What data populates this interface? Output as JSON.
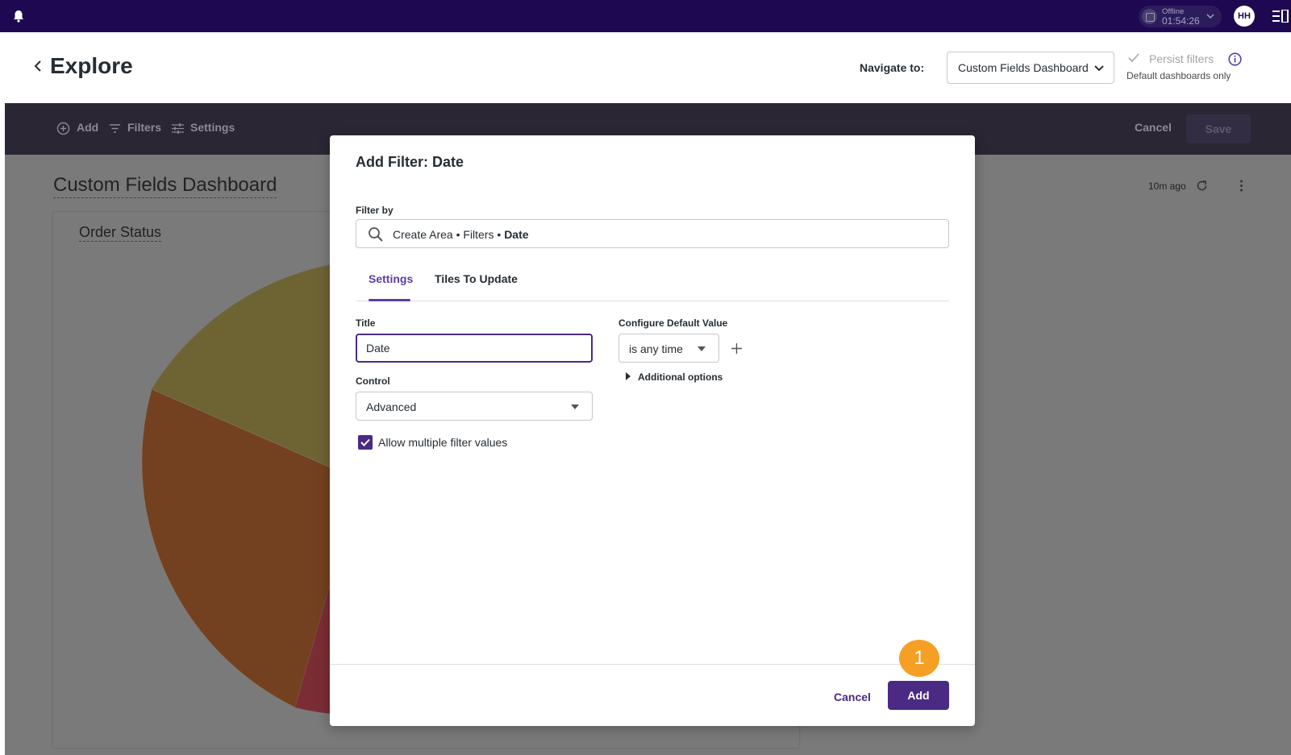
{
  "topbar": {
    "timer_status": "Offline",
    "timer_time": "01:54:26",
    "avatar_initials": "HH"
  },
  "header": {
    "title": "Explore",
    "navigate_label": "Navigate to:",
    "navigate_value": "Custom Fields Dashboard",
    "persist_label": "Persist filters",
    "persist_sub": "Default dashboards only"
  },
  "toolbar": {
    "add_label": "Add",
    "filters_label": "Filters",
    "settings_label": "Settings",
    "cancel_label": "Cancel",
    "save_label": "Save"
  },
  "dashboard": {
    "title": "Custom Fields Dashboard",
    "updated": "10m ago",
    "tile_title": "Order Status"
  },
  "modal": {
    "title": "Add Filter: Date",
    "filter_by_label": "Filter by",
    "filter_path_prefix": "Create Area • Filters • ",
    "filter_path_field": "Date",
    "tabs": [
      {
        "label": "Settings"
      },
      {
        "label": "Tiles To Update"
      }
    ],
    "title_label": "Title",
    "title_value": "Date",
    "control_label": "Control",
    "control_value": "Advanced",
    "allow_multiple_label": "Allow multiple filter values",
    "allow_multiple_checked": true,
    "default_value_label": "Configure Default Value",
    "default_value": "is any time",
    "additional_options_label": "Additional options",
    "cancel_label": "Cancel",
    "add_label": "Add",
    "step_badge": "1"
  },
  "colors": {
    "topbar": "#1f0852",
    "accent": "#4b2a84",
    "badge": "#f5a025"
  }
}
